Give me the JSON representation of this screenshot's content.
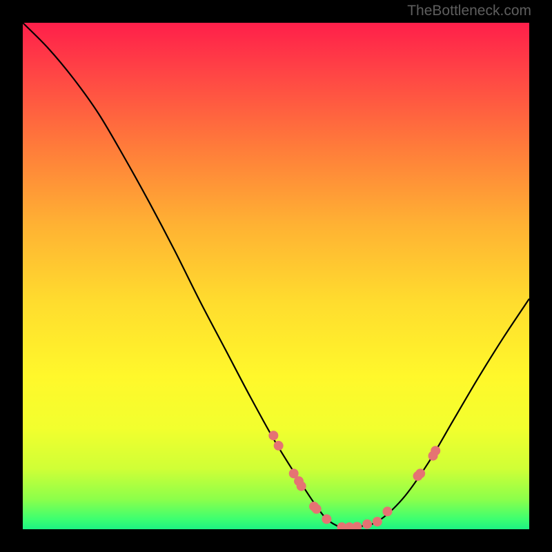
{
  "watermark": "TheBottleneck.com",
  "chart_data": {
    "type": "line",
    "title": "",
    "xlabel": "",
    "ylabel": "",
    "xlim": [
      0,
      100
    ],
    "ylim": [
      0,
      100
    ],
    "gradient_colors": {
      "top": "#ff1f4a",
      "bottom": "#1cf283"
    },
    "curve": {
      "description": "V-shaped bottleneck curve descending from upper-left to a minimum near x≈63 then rising to the right edge",
      "points_xy_percent": [
        [
          0,
          100
        ],
        [
          5,
          95
        ],
        [
          10,
          89
        ],
        [
          15,
          82
        ],
        [
          20,
          73.5
        ],
        [
          25,
          64.5
        ],
        [
          30,
          55
        ],
        [
          35,
          45
        ],
        [
          40,
          35.5
        ],
        [
          45,
          26
        ],
        [
          50,
          17
        ],
        [
          55,
          9
        ],
        [
          58,
          4.5
        ],
        [
          60,
          2
        ],
        [
          62,
          0.7
        ],
        [
          63,
          0.4
        ],
        [
          66,
          0.5
        ],
        [
          70,
          1.5
        ],
        [
          75,
          6
        ],
        [
          80,
          13
        ],
        [
          85,
          21.5
        ],
        [
          90,
          30
        ],
        [
          95,
          38
        ],
        [
          100,
          45.5
        ]
      ]
    },
    "markers": {
      "color": "#e57373",
      "radius_px": 7,
      "points_xy_percent": [
        [
          49.5,
          18.5
        ],
        [
          50.5,
          16.5
        ],
        [
          53.5,
          11
        ],
        [
          54.5,
          9.5
        ],
        [
          55,
          8.5
        ],
        [
          57.5,
          4.5
        ],
        [
          58,
          4
        ],
        [
          60,
          2
        ],
        [
          63,
          0.4
        ],
        [
          64.5,
          0.4
        ],
        [
          66,
          0.5
        ],
        [
          68,
          1
        ],
        [
          70,
          1.5
        ],
        [
          72,
          3.5
        ],
        [
          78,
          10.5
        ],
        [
          78.5,
          11
        ],
        [
          81,
          14.5
        ],
        [
          81.5,
          15.5
        ]
      ]
    }
  }
}
